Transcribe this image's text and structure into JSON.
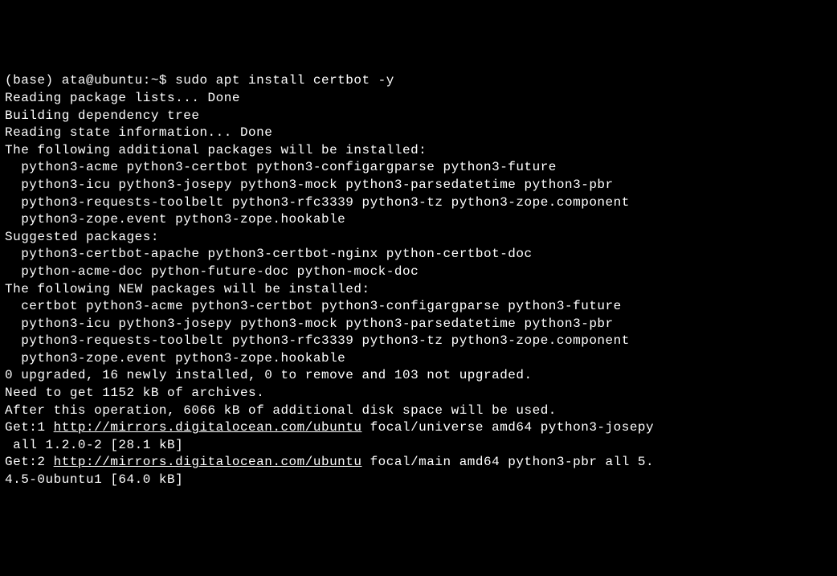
{
  "terminal": {
    "prompt": "(base) ata@ubuntu:~$ ",
    "command": "sudo apt install certbot -y",
    "lines": [
      "Reading package lists... Done",
      "Building dependency tree",
      "Reading state information... Done",
      "The following additional packages will be installed:",
      "  python3-acme python3-certbot python3-configargparse python3-future",
      "  python3-icu python3-josepy python3-mock python3-parsedatetime python3-pbr",
      "  python3-requests-toolbelt python3-rfc3339 python3-tz python3-zope.component",
      "  python3-zope.event python3-zope.hookable",
      "Suggested packages:",
      "  python3-certbot-apache python3-certbot-nginx python-certbot-doc",
      "  python-acme-doc python-future-doc python-mock-doc",
      "The following NEW packages will be installed:",
      "  certbot python3-acme python3-certbot python3-configargparse python3-future",
      "  python3-icu python3-josepy python3-mock python3-parsedatetime python3-pbr",
      "  python3-requests-toolbelt python3-rfc3339 python3-tz python3-zope.component",
      "  python3-zope.event python3-zope.hookable",
      "0 upgraded, 16 newly installed, 0 to remove and 103 not upgraded.",
      "Need to get 1152 kB of archives.",
      "After this operation, 6066 kB of additional disk space will be used."
    ],
    "get1_prefix": "Get:1 ",
    "get1_url": "http://mirrors.digitalocean.com/ubuntu",
    "get1_suffix": " focal/universe amd64 python3-josepy",
    "get1_cont": " all 1.2.0-2 [28.1 kB]",
    "get2_prefix": "Get:2 ",
    "get2_url": "http://mirrors.digitalocean.com/ubuntu",
    "get2_suffix": " focal/main amd64 python3-pbr all 5.",
    "get2_cont": "4.5-0ubuntu1 [64.0 kB]"
  }
}
